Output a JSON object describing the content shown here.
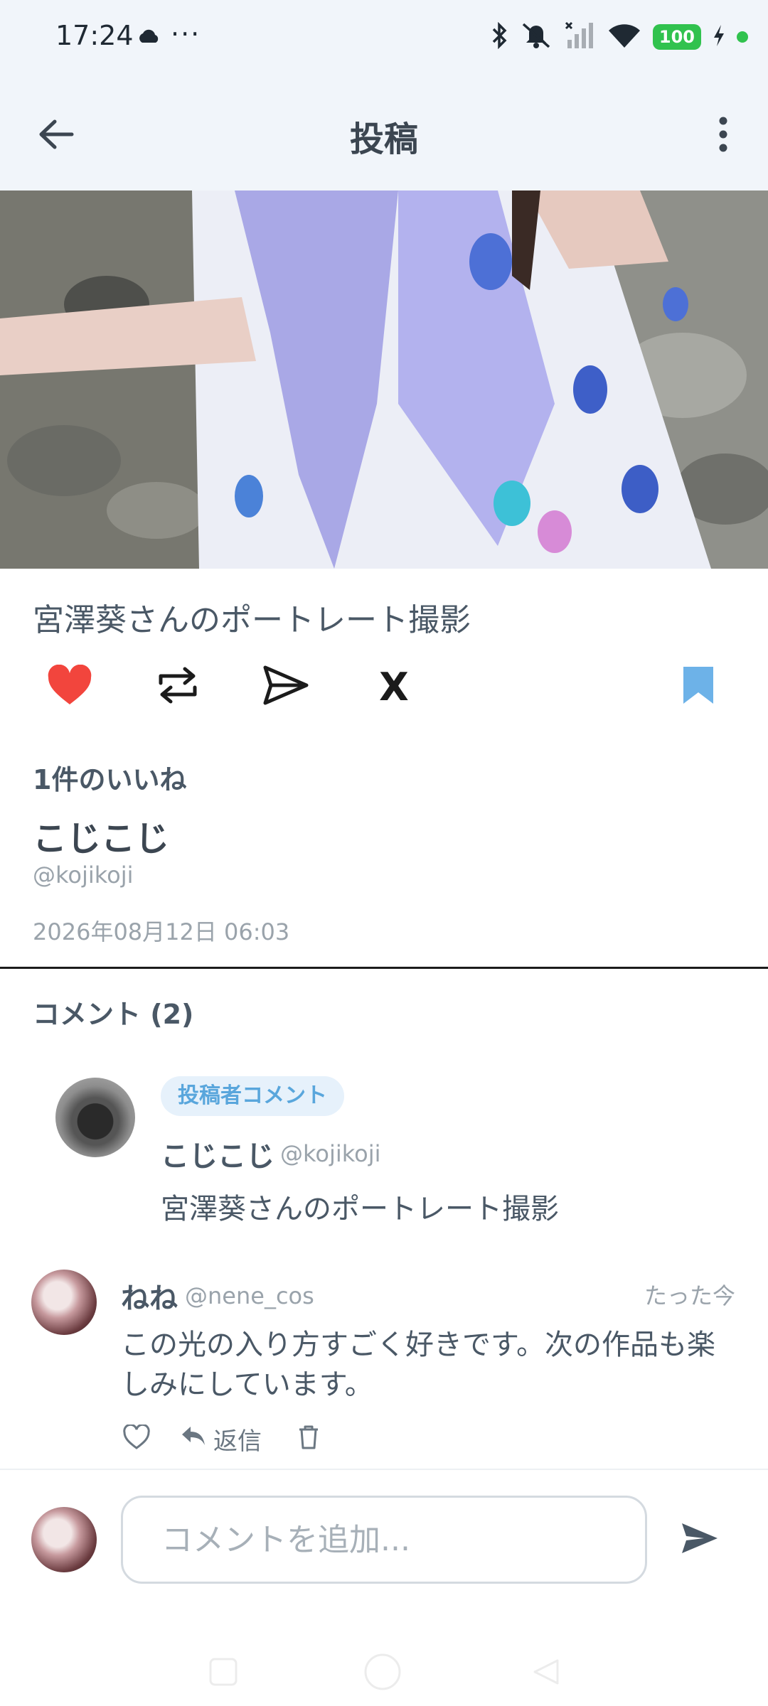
{
  "status_bar": {
    "time": "17:24",
    "dots": "···",
    "battery": "100",
    "icons": [
      "cloud-icon",
      "bluetooth-icon",
      "mute-icon",
      "signal-icon",
      "wifi-icon",
      "battery-icon",
      "charging-icon"
    ]
  },
  "app_bar": {
    "title": "投稿",
    "back_icon": "arrow-left-icon",
    "more_icon": "more-vertical-icon"
  },
  "post": {
    "title": "宮澤葵さんのポートレート撮影",
    "likes_text": "1件のいいね",
    "author_name": "こじこじ",
    "author_handle": "@kojikoji",
    "date": "2026年08月12日 06:03",
    "actions": {
      "x_label": "X",
      "like_color": "#f2453d",
      "bookmark_color": "#6db2e8"
    }
  },
  "comments": {
    "header": "コメント (2)",
    "owner_comment": {
      "badge": "投稿者コメント",
      "name": "こじこじ",
      "handle": "@kojikoji",
      "text": "宮澤葵さんのポートレート撮影"
    },
    "items": [
      {
        "name": "ねね",
        "handle": "@nene_cos",
        "time": "たった今",
        "text": "この光の入り方すごく好きです。次の作品も楽しみにしています。",
        "reply_label": "返信"
      }
    ]
  },
  "input": {
    "placeholder": "コメントを追加..."
  },
  "colors": {
    "header_bg": "#f1f5fa",
    "badge_bg": "#e6f1fb",
    "badge_text": "#59a6dc",
    "text_primary": "#4a5866",
    "text_muted": "#9aa3ab"
  }
}
